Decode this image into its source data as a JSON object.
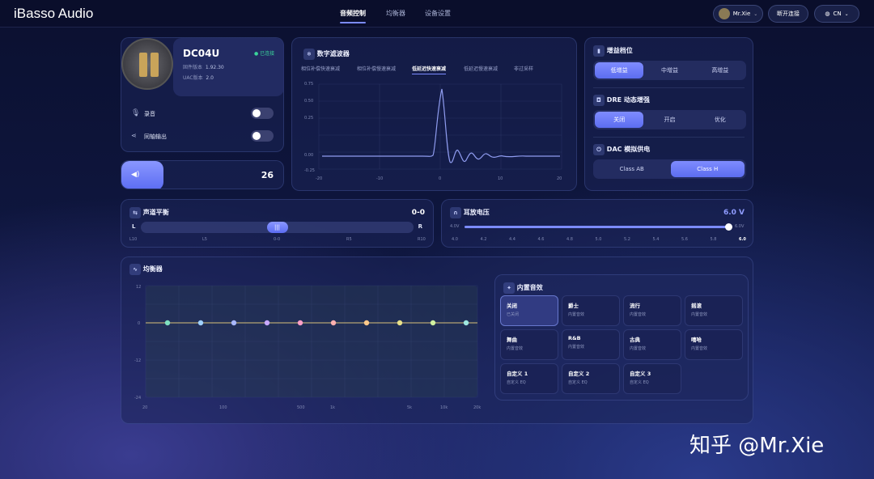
{
  "app": {
    "title": "iBasso Audio"
  },
  "nav": {
    "tabs": [
      {
        "label": "音频控制"
      },
      {
        "label": "均衡器"
      },
      {
        "label": "设备设置"
      }
    ]
  },
  "header": {
    "user": "Mr.Xie",
    "disconnect": "断开连接",
    "lang": "CN"
  },
  "device": {
    "name": "DC04U",
    "status": "已连接",
    "fw_label": "固件版本",
    "fw": "1.92.30",
    "uac_label": "UAC版本",
    "uac": "2.0",
    "record_label": "录音",
    "coax_label": "同轴输出"
  },
  "volume": {
    "value": "26"
  },
  "filter": {
    "title": "数字滤波器",
    "tabs": [
      "相位补偿快速衰减",
      "相位补偿慢速衰减",
      "低延迟快速衰减",
      "低延迟慢速衰减",
      "非过采样"
    ],
    "selected": 2,
    "y_ticks": [
      "0.75",
      "0.50",
      "0.25",
      "0.00",
      "-0.25"
    ],
    "x_ticks": [
      "-20",
      "-10",
      "0",
      "10",
      "20"
    ]
  },
  "gain": {
    "title": "增益档位",
    "options": [
      "低增益",
      "中增益",
      "高增益"
    ],
    "selected": 0
  },
  "dre": {
    "title": "DRE 动态增强",
    "options": [
      "关闭",
      "开启",
      "优化"
    ],
    "selected": 0
  },
  "dac": {
    "title": "DAC 模拟供电",
    "options": [
      "Class AB",
      "Class H"
    ],
    "selected": 1
  },
  "balance": {
    "title": "声道平衡",
    "value": "0-0",
    "left": "L",
    "right": "R",
    "position": 0.5,
    "ticks": [
      "L10",
      "L5",
      "0-0",
      "R5",
      "R10"
    ]
  },
  "voltage": {
    "title": "耳放电压",
    "value": "6.0 V",
    "min": "4.0V",
    "max": "6.0V",
    "level": 1.0,
    "ticks": [
      "4.0",
      "4.2",
      "4.4",
      "4.6",
      "4.8",
      "5.0",
      "5.2",
      "5.4",
      "5.6",
      "5.8",
      "6.0"
    ]
  },
  "eq": {
    "title": "均衡器",
    "y_ticks": [
      "12",
      "0",
      "-12",
      "-24"
    ],
    "x_ticks": [
      "20",
      "100",
      "500",
      "1k",
      "5k",
      "10k",
      "20k"
    ],
    "bands": [
      0,
      0,
      0,
      0,
      0,
      0,
      0,
      0,
      0,
      0
    ],
    "band_colors": [
      "#7fe0c0",
      "#9fd0ff",
      "#a9b8ff",
      "#c8a8ff",
      "#ff9fc8",
      "#ffb0b0",
      "#ffc98a",
      "#e8e08a",
      "#d0f0a0",
      "#9fe8e0"
    ]
  },
  "presets": {
    "title": "内置音效",
    "items": [
      {
        "name": "关闭",
        "desc": "已关闭"
      },
      {
        "name": "爵士",
        "desc": "内置音效"
      },
      {
        "name": "流行",
        "desc": "内置音效"
      },
      {
        "name": "摇滚",
        "desc": "内置音效"
      },
      {
        "name": "舞曲",
        "desc": "内置音效"
      },
      {
        "name": "R&B",
        "desc": "内置音效"
      },
      {
        "name": "古典",
        "desc": "内置音效"
      },
      {
        "name": "嘻哈",
        "desc": "内置音效"
      },
      {
        "name": "自定义 1",
        "desc": "自定义 EQ"
      },
      {
        "name": "自定义 2",
        "desc": "自定义 EQ"
      },
      {
        "name": "自定义 3",
        "desc": "自定义 EQ"
      }
    ],
    "selected": 0
  },
  "watermark": "知乎 @Mr.Xie",
  "colors": {
    "accent": "#7b8bff",
    "online": "#3ad49a"
  }
}
